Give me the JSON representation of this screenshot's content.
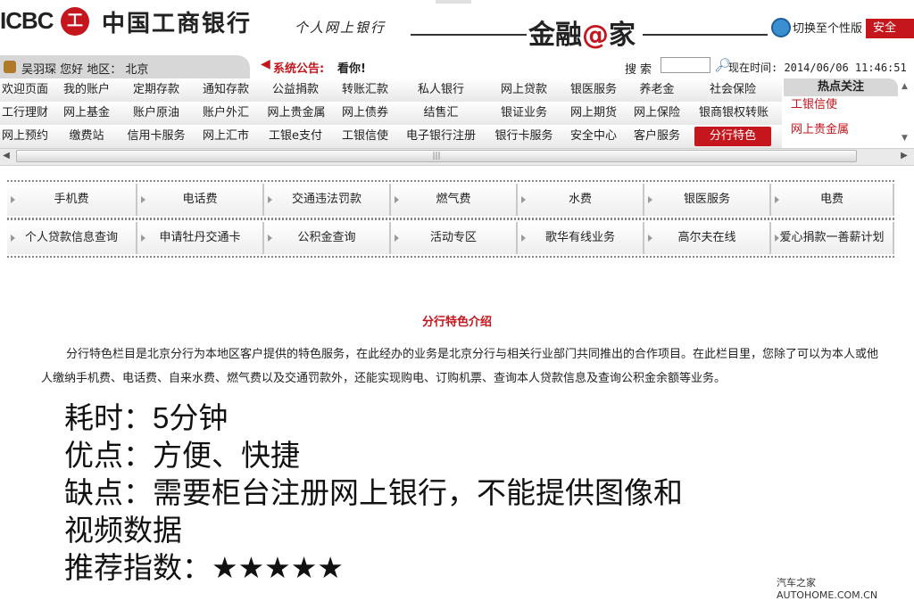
{
  "header": {
    "logo_icbc": "ICBC",
    "logo_mark": "工",
    "bank_name": "中国工商银行",
    "subtitle": "个人网上银行",
    "brand_prefix": "金融",
    "brand_at": "@",
    "brand_suffix": "家",
    "switch_label": "切换至个性版",
    "security_label": "安全"
  },
  "infobar": {
    "user_text": "吴羽琛  您好  地区：  北京",
    "notice_label": "系统公告:",
    "notice_text": "看你!",
    "search_label": "搜索",
    "search_value": "",
    "time_text": "现在时间: 2014/06/06 11:46:51"
  },
  "nav": {
    "rows": [
      [
        "欢迎页面",
        "我的账户",
        "定期存款",
        "通知存款",
        "公益捐款",
        "转账汇款",
        "私人银行",
        "网上贷款",
        "银医服务",
        "养老金",
        "社会保险"
      ],
      [
        "工行理财",
        "网上基金",
        "账户原油",
        "账户外汇",
        "网上贵金属",
        "网上债券",
        "结售汇",
        "银证业务",
        "网上期货",
        "网上保险",
        "银商银权转账"
      ],
      [
        "网上预约",
        "缴费站",
        "信用卡服务",
        "网上汇市",
        "工银e支付",
        "工银信使",
        "电子银行注册",
        "银行卡服务",
        "安全中心",
        "客户服务",
        "分行特色"
      ]
    ]
  },
  "hot": {
    "title": "热点关注",
    "items": [
      "工银信使",
      "网上贵金属"
    ]
  },
  "services": {
    "row1": [
      "手机费",
      "电话费",
      "交通违法罚款",
      "燃气费",
      "水费",
      "银医服务",
      "电费"
    ],
    "row2": [
      "个人贷款信息查询",
      "申请牡丹交通卡",
      "公积金查询",
      "活动专区",
      "歌华有线业务",
      "高尔夫在线",
      "爱心捐款一善薪计划"
    ]
  },
  "content": {
    "title": "分行特色介绍",
    "body": "分行特色栏目是北京分行为本地区客户提供的特色服务，在此经办的业务是北京分行与相关行业部门共同推出的合作项目。在此栏目里，您除了可以为本人或他人缴纳手机费、电话费、自来水费、燃气费以及交通罚款外，还能实现购电、订购机票、查询本人贷款信息及查询公积金余额等业务。"
  },
  "review": {
    "time": "耗时：5分钟",
    "pros": "优点：方便、快捷",
    "cons_1": "缺点：需要柜台注册网上银行，不能提供图像和",
    "cons_2": "视频数据",
    "rating": "推荐指数：★★★★★"
  },
  "watermark": "汽车之家  AUTOHOME.COM.CN",
  "colors": {
    "accent": "#c4161c",
    "nav_bg": "#e8e8e8"
  }
}
